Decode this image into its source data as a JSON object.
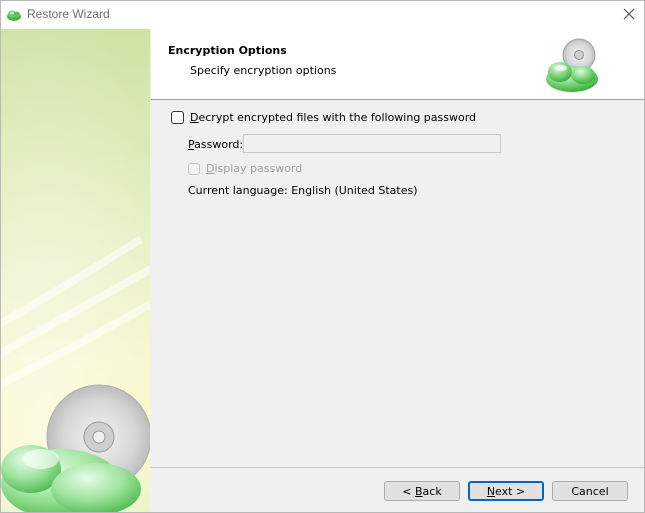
{
  "window": {
    "title": "Restore Wizard",
    "icons": {
      "app": "green-cloud-icon",
      "close": "close-icon"
    }
  },
  "header": {
    "title": "Encryption Options",
    "subtitle": "Specify encryption options",
    "logo_icon": "cloud-disc-icon"
  },
  "content": {
    "decrypt_checkbox": {
      "label_prefix": "D",
      "label_rest": "ecrypt encrypted files with the following password",
      "checked": false
    },
    "password": {
      "label_prefix": "P",
      "label_rest": "assword:",
      "value": "",
      "enabled": false
    },
    "display_password": {
      "label_prefix": "D",
      "label_rest": "isplay password",
      "checked": false,
      "enabled": false
    },
    "current_language": "Current language: English (United States)"
  },
  "buttons": {
    "back": {
      "prefix": "< ",
      "underlined": "B",
      "rest": "ack"
    },
    "next": {
      "prefix": "",
      "underlined": "N",
      "rest": "ext >"
    },
    "cancel": {
      "label": "Cancel"
    }
  },
  "colors": {
    "accent": "#0067c0",
    "dialog_bg": "#f0f0f0",
    "cloud_green": "#3ab53a",
    "side_art_green": "#cfe3a6"
  }
}
